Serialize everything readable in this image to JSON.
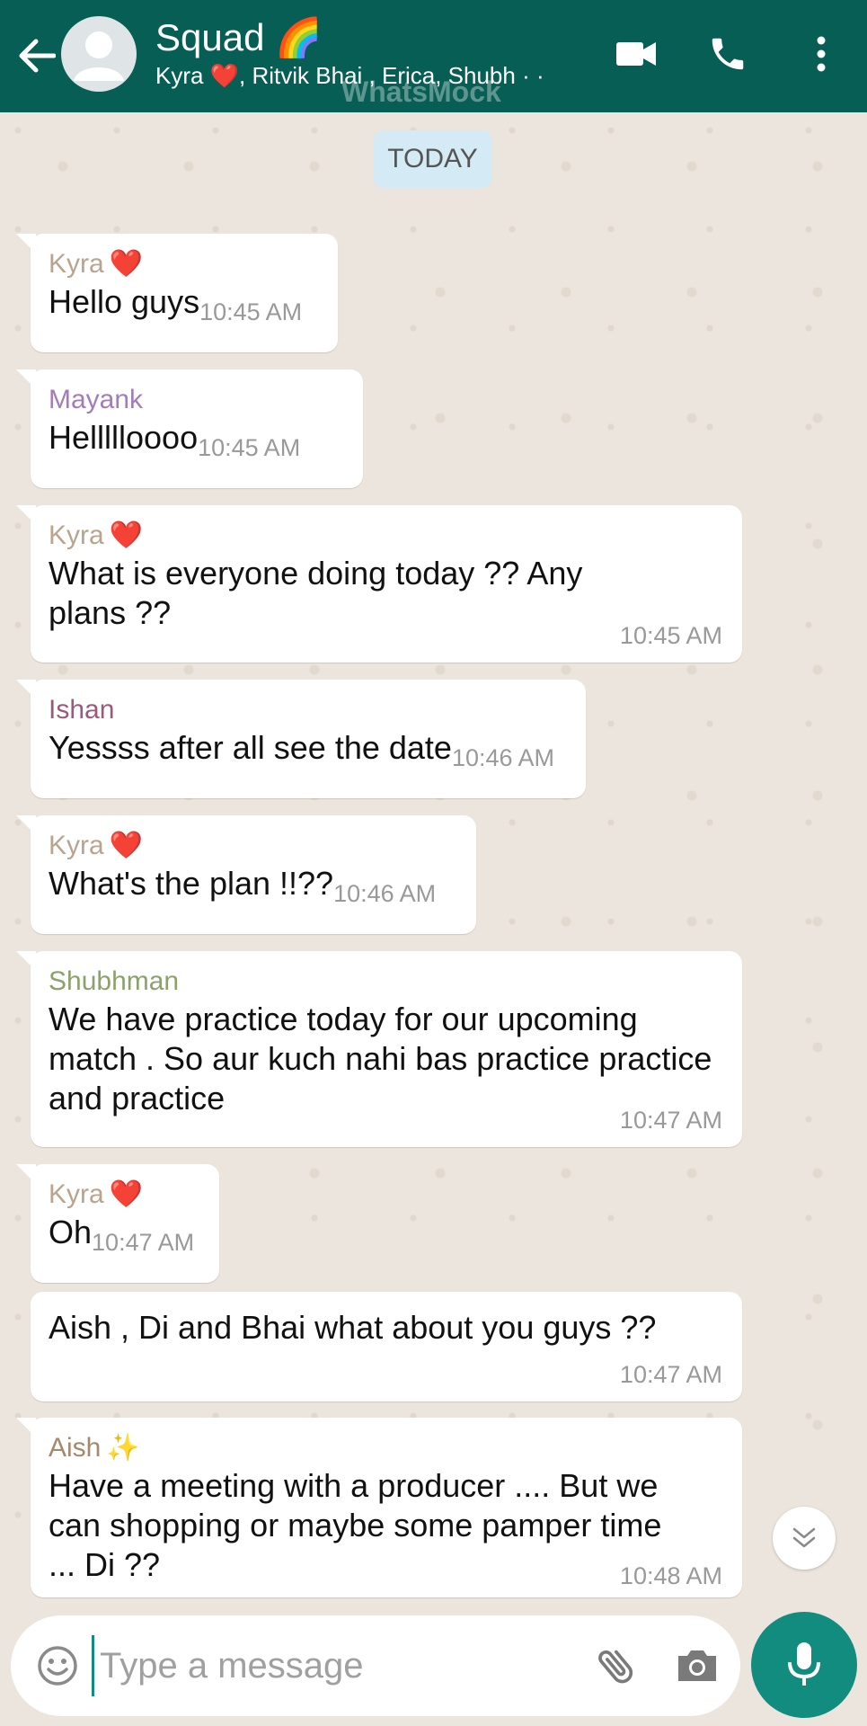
{
  "header": {
    "title": "Squad 🌈",
    "subtitle": "Kyra ❤️, Ritvik Bhai , Erica, Shubh · ·",
    "watermark": "WhatsMock",
    "icons": [
      "back-arrow-icon",
      "avatar-placeholder-icon",
      "video-call-icon",
      "voice-call-icon",
      "more-vertical-icon"
    ]
  },
  "date_chip": "TODAY",
  "colors": {
    "header": "#075e54",
    "accent": "#128c7e",
    "background": "#ece5dd"
  },
  "messages": [
    {
      "sender": "Kyra",
      "sender_emoji": "❤️",
      "sender_color": "#b8a48f",
      "text": "Hello guys",
      "time": "10:45 AM"
    },
    {
      "sender": "Mayank",
      "sender_emoji": "",
      "sender_color": "#a37cba",
      "text": "Hellllloooo",
      "time": "10:45 AM"
    },
    {
      "sender": "Kyra",
      "sender_emoji": "❤️",
      "sender_color": "#b8a48f",
      "text": "What is everyone doing today ?? Any plans ??",
      "time": "10:45 AM"
    },
    {
      "sender": "Ishan",
      "sender_emoji": "",
      "sender_color": "#9a5a7c",
      "text": "Yessss after all see the date",
      "time": "10:46 AM"
    },
    {
      "sender": "Kyra",
      "sender_emoji": "❤️",
      "sender_color": "#b8a48f",
      "text": "What's the plan !!??",
      "time": "10:46 AM"
    },
    {
      "sender": "Shubhman",
      "sender_emoji": "",
      "sender_color": "#8ca26b",
      "text": "We have practice today for our upcoming match . So aur kuch nahi bas practice practice and practice",
      "time": "10:47 AM"
    },
    {
      "sender": "Kyra",
      "sender_emoji": "❤️",
      "sender_color": "#b8a48f",
      "text": "Oh",
      "time": "10:47 AM"
    },
    {
      "sender": "",
      "sender_emoji": "",
      "sender_color": "",
      "text": "Aish , Di and Bhai what about you guys ??",
      "time": "10:47 AM"
    },
    {
      "sender": "Aish",
      "sender_emoji": "✨",
      "sender_color": "#a5896a",
      "text": "Have a meeting with a producer .... But we can shopping or maybe some pamper time ... Di ??",
      "time": "10:48 AM"
    }
  ],
  "input": {
    "placeholder": "Type a message",
    "value": ""
  }
}
